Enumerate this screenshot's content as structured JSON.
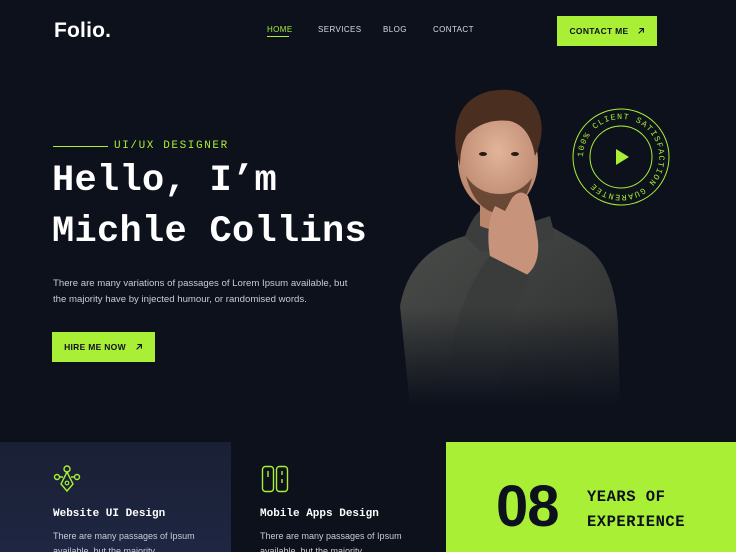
{
  "brand": {
    "logo": "Folio."
  },
  "nav": {
    "items": [
      {
        "label": "HOME",
        "active": true
      },
      {
        "label": "SERVICES",
        "active": false
      },
      {
        "label": "BLOG",
        "active": false
      },
      {
        "label": "CONTACT",
        "active": false
      }
    ],
    "cta_label": "CONTACT ME",
    "cta_icon": "arrow-up-right-icon"
  },
  "hero": {
    "role": "UI/UX DESIGNER",
    "title_line1": "Hello, I’m",
    "title_line2": "Michle Collins",
    "description": "There are many variations of passages of Lorem Ipsum available, but the majority have by injected humour, or randomised words.",
    "cta_label": "HIRE ME NOW",
    "cta_icon": "arrow-up-right-icon"
  },
  "badge": {
    "text": "100% CLIENT SATISFACTION GUARENTEE",
    "icon": "play-icon"
  },
  "services": [
    {
      "title": "Website UI Design",
      "text": "There are many passages of Ipsum available, but the majority",
      "icon": "design-tool-icon"
    },
    {
      "title": "Mobile Apps Design",
      "text": "There are many passages of Ipsum available, but the majority",
      "icon": "mobile-apps-icon"
    }
  ],
  "experience": {
    "number": "08",
    "line1": "YEARS OF",
    "line2": "EXPERIENCE"
  },
  "colors": {
    "accent": "#a8ef36",
    "background": "#0d111c",
    "card": "#1a2034"
  }
}
